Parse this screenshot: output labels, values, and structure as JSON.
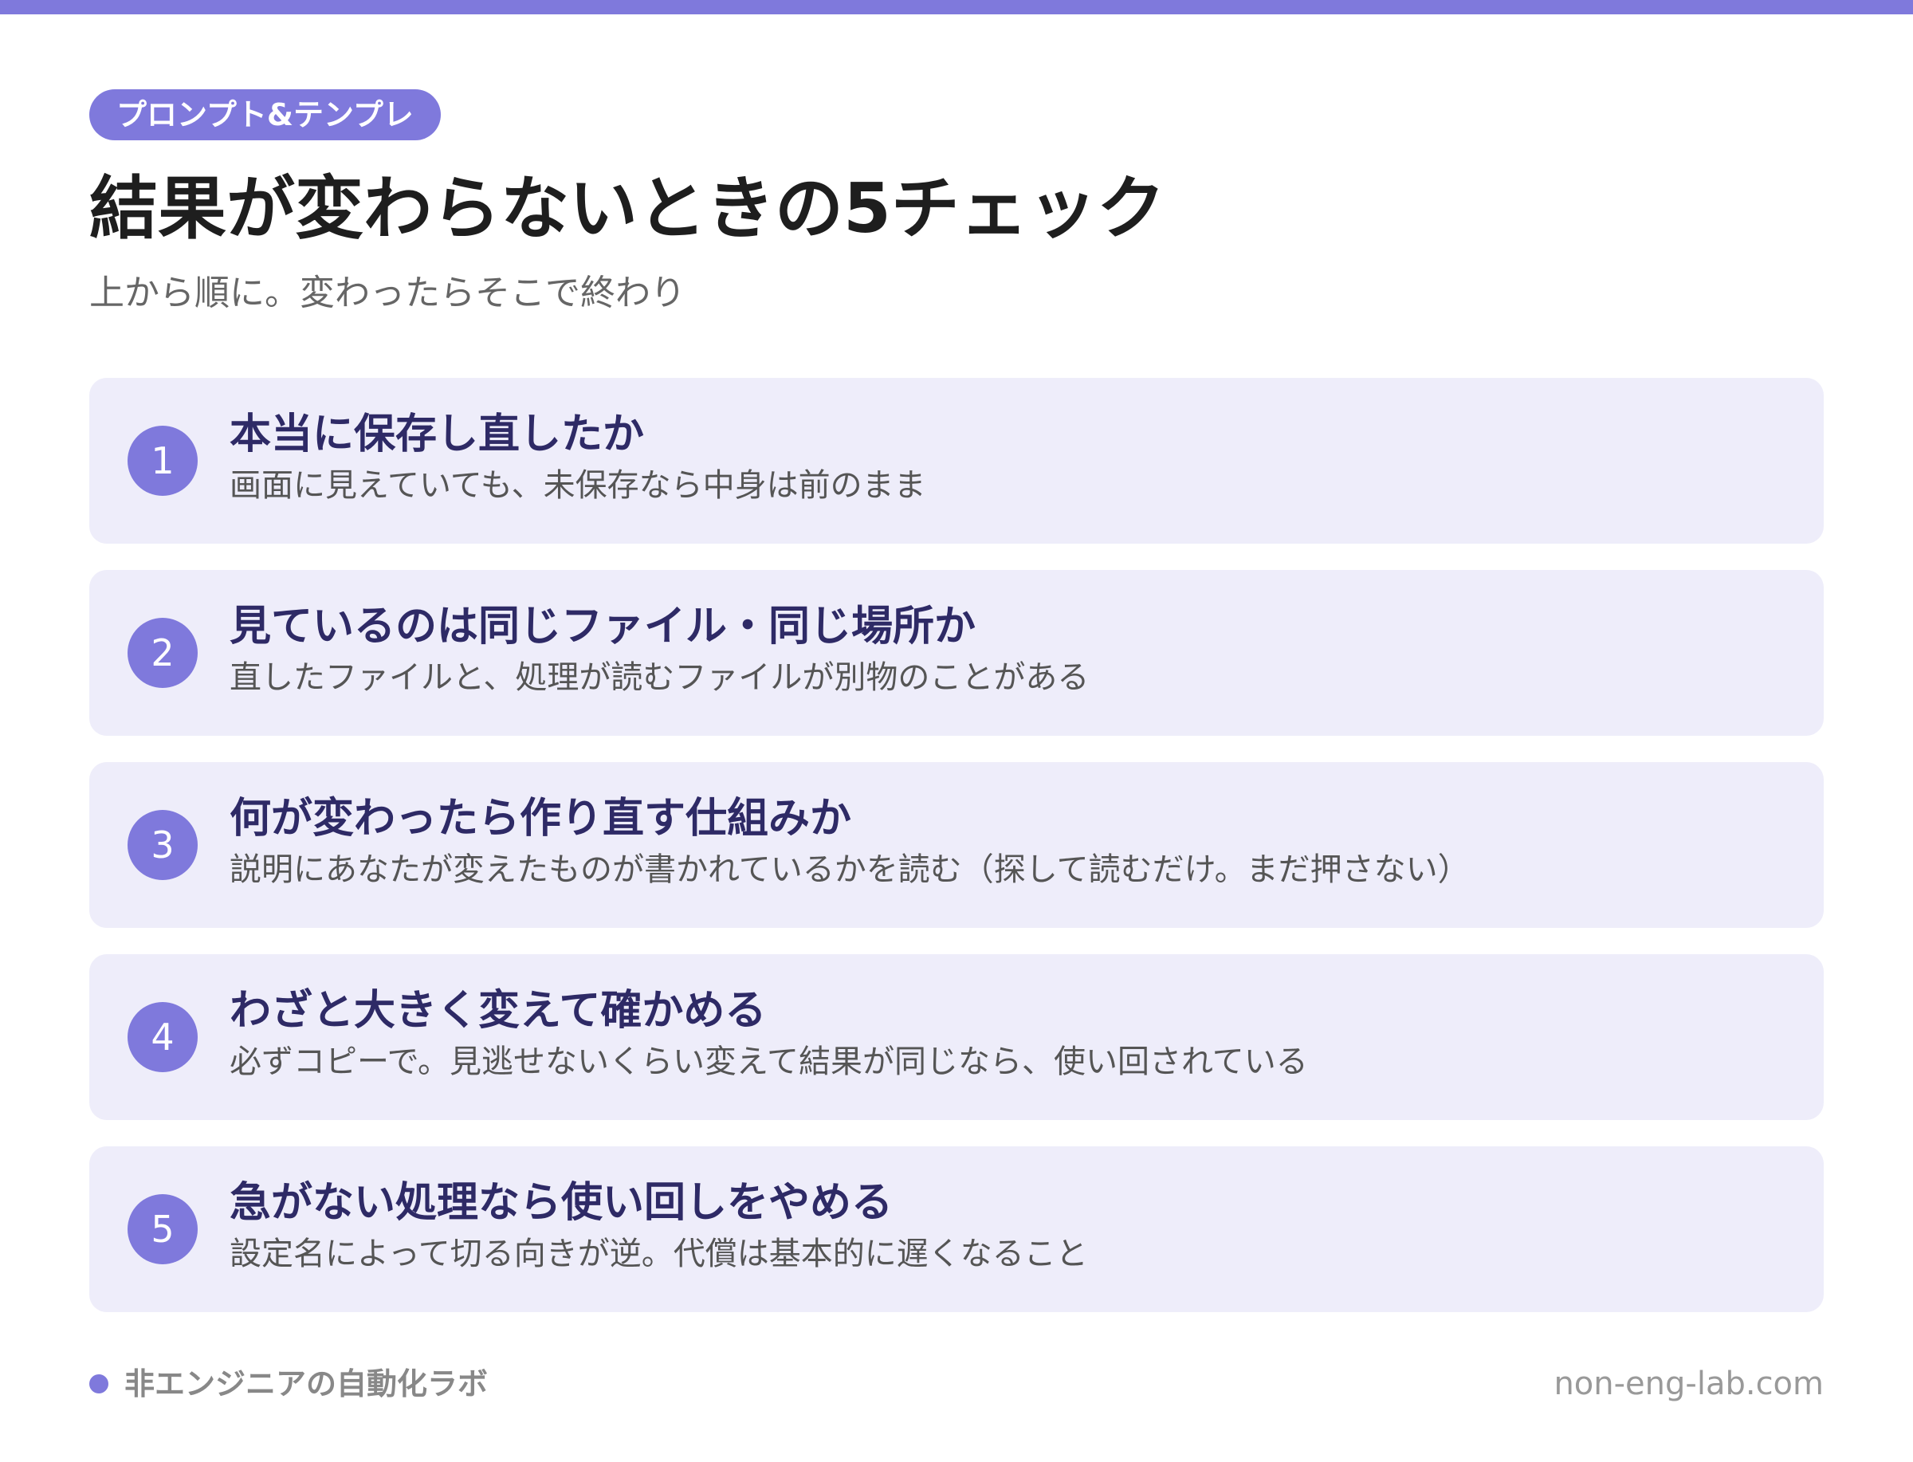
{
  "tag": "プロンプト&テンプレ",
  "title": "結果が変わらないときの5チェック",
  "subtitle": "上から順に。変わったらそこで終わり",
  "checks": [
    {
      "number": "1",
      "title": "本当に保存し直したか",
      "desc": "画面に見えていても、未保存なら中身は前のまま"
    },
    {
      "number": "2",
      "title": "見ているのは同じファイル・同じ場所か",
      "desc": "直したファイルと、処理が読むファイルが別物のことがある"
    },
    {
      "number": "3",
      "title": "何が変わったら作り直す仕組みか",
      "desc": "説明にあなたが変えたものが書かれているかを読む（探して読むだけ。まだ押さない）"
    },
    {
      "number": "4",
      "title": "わざと大きく変えて確かめる",
      "desc": "必ずコピーで。見逃せないくらい変えて結果が同じなら、使い回されている"
    },
    {
      "number": "5",
      "title": "急がない処理なら使い回しをやめる",
      "desc": "設定名によって切る向きが逆。代償は基本的に遅くなること"
    }
  ],
  "footer": {
    "brand": "非エンジニアの自動化ラボ",
    "url": "non-eng-lab.com"
  },
  "colors": {
    "accent": "#7f79dc",
    "card_bg": "#eeedfa",
    "card_title": "#2e2a66"
  }
}
